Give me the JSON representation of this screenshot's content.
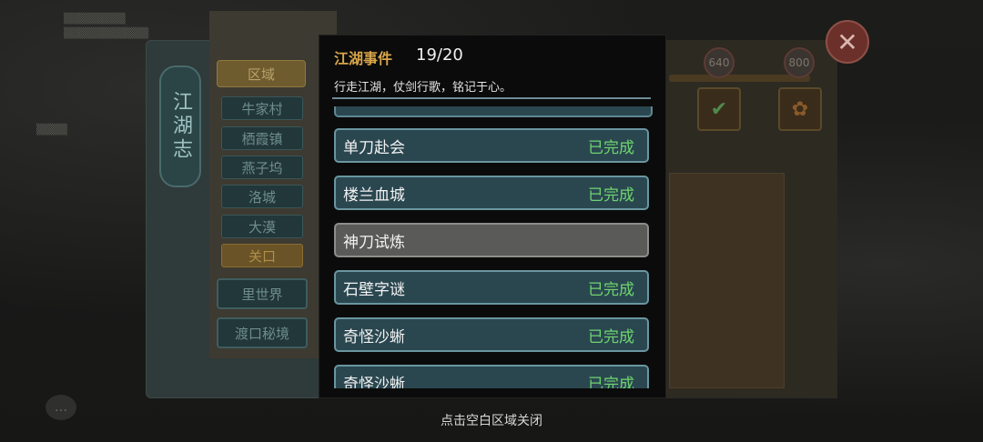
{
  "modal": {
    "title": "江湖事件",
    "count": "19/20",
    "subtitle": "行走江湖，仗剑行歌，铭记于心。",
    "events": [
      {
        "name": "单刀赴会",
        "status": "已完成",
        "completed": true
      },
      {
        "name": "楼兰血城",
        "status": "已完成",
        "completed": true
      },
      {
        "name": "神刀试炼",
        "status": "",
        "completed": false
      },
      {
        "name": "石壁字谜",
        "status": "已完成",
        "completed": true
      },
      {
        "name": "奇怪沙蜥",
        "status": "已完成",
        "completed": true
      },
      {
        "name": "奇怪沙蜥",
        "status": "已完成",
        "completed": true
      }
    ]
  },
  "book": {
    "title": "江湖志",
    "region_header": "区域",
    "regions": [
      {
        "label": "牛家村",
        "active": false
      },
      {
        "label": "栖霞镇",
        "active": false
      },
      {
        "label": "燕子坞",
        "active": false
      },
      {
        "label": "洛城",
        "active": false
      },
      {
        "label": "大漠",
        "active": false
      },
      {
        "label": "关口",
        "active": true
      }
    ],
    "secret_world": "里世界",
    "ferry_realm": "渡口秘境"
  },
  "progress": {
    "milestones": [
      "640",
      "800"
    ]
  },
  "close_hint": "点击空白区域关闭",
  "colors": {
    "title_gold": "#d9a54a",
    "completed_green": "#6fd46f",
    "row_teal": "#2a4750",
    "row_pending": "#5a5a58"
  }
}
